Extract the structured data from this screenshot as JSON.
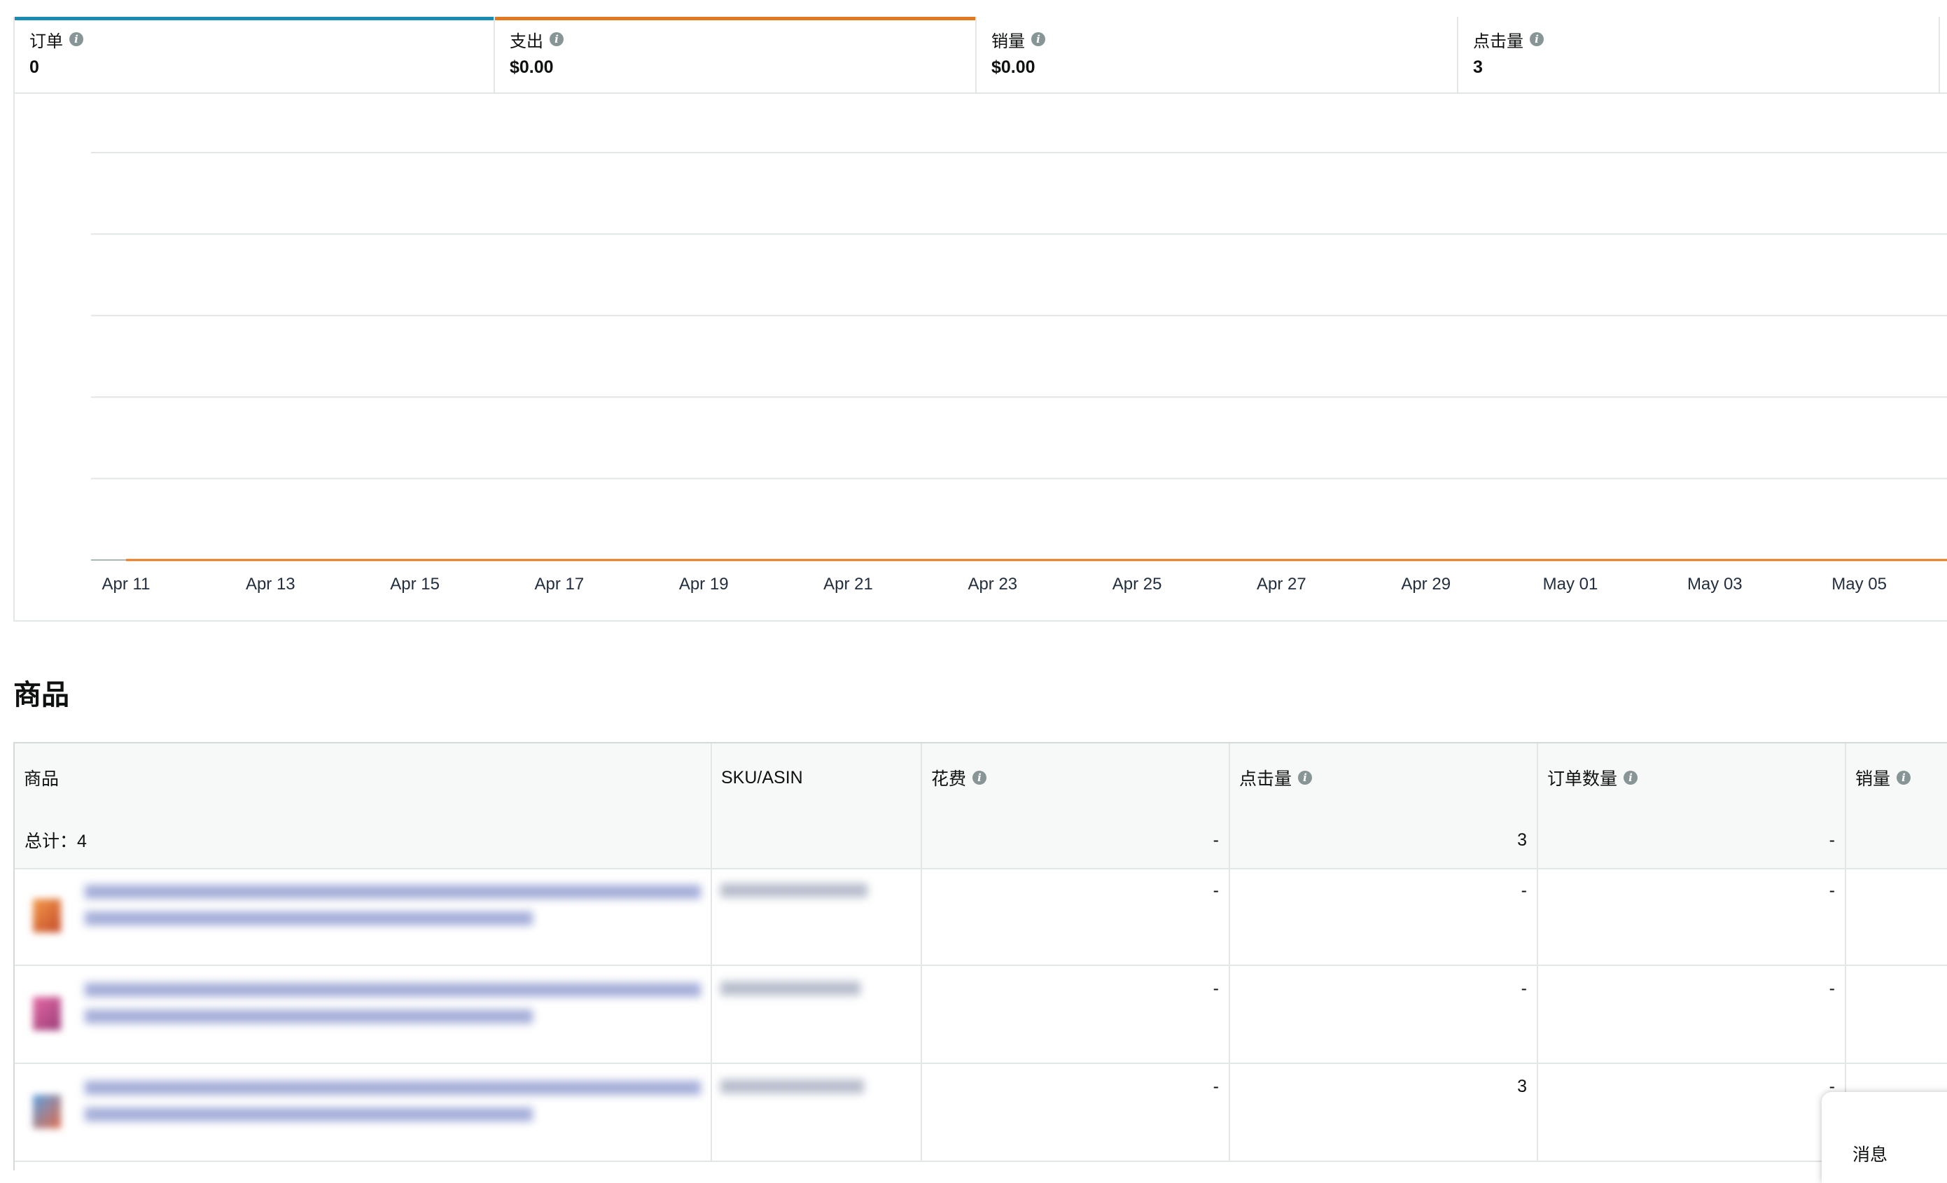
{
  "metrics": [
    {
      "label": "订单",
      "value": "0",
      "color": "#1a8bb3"
    },
    {
      "label": "支出",
      "value": "$0.00",
      "color": "#e3791e"
    },
    {
      "label": "销量",
      "value": "$0.00",
      "color": ""
    },
    {
      "label": "点击量",
      "value": "3",
      "color": ""
    }
  ],
  "info_glyph": "i",
  "chart_data": {
    "type": "line",
    "x": [
      "Apr 11",
      "Apr 13",
      "Apr 15",
      "Apr 17",
      "Apr 19",
      "Apr 21",
      "Apr 23",
      "Apr 25",
      "Apr 27",
      "Apr 29",
      "May 01",
      "May 03",
      "May 05"
    ],
    "series": [
      {
        "values": [
          0,
          0,
          0,
          0,
          0,
          0,
          0,
          0,
          0,
          0,
          0,
          0,
          0
        ],
        "color": "#e3791e"
      }
    ],
    "grid": true,
    "grid_lines": 6
  },
  "products": {
    "title": "商品",
    "columns": {
      "product": "商品",
      "sku": "SKU/ASIN",
      "cost": "花费",
      "clicks": "点击量",
      "orders": "订单数量",
      "sales": "销量"
    },
    "total": {
      "label": "总计：4",
      "cost": "-",
      "clicks": "3",
      "orders": "-"
    },
    "rows": [
      {
        "cost": "-",
        "clicks": "-",
        "orders": "-"
      },
      {
        "cost": "-",
        "clicks": "-",
        "orders": "-"
      },
      {
        "cost": "-",
        "clicks": "3",
        "orders": "-"
      }
    ]
  },
  "message_button": "消息"
}
